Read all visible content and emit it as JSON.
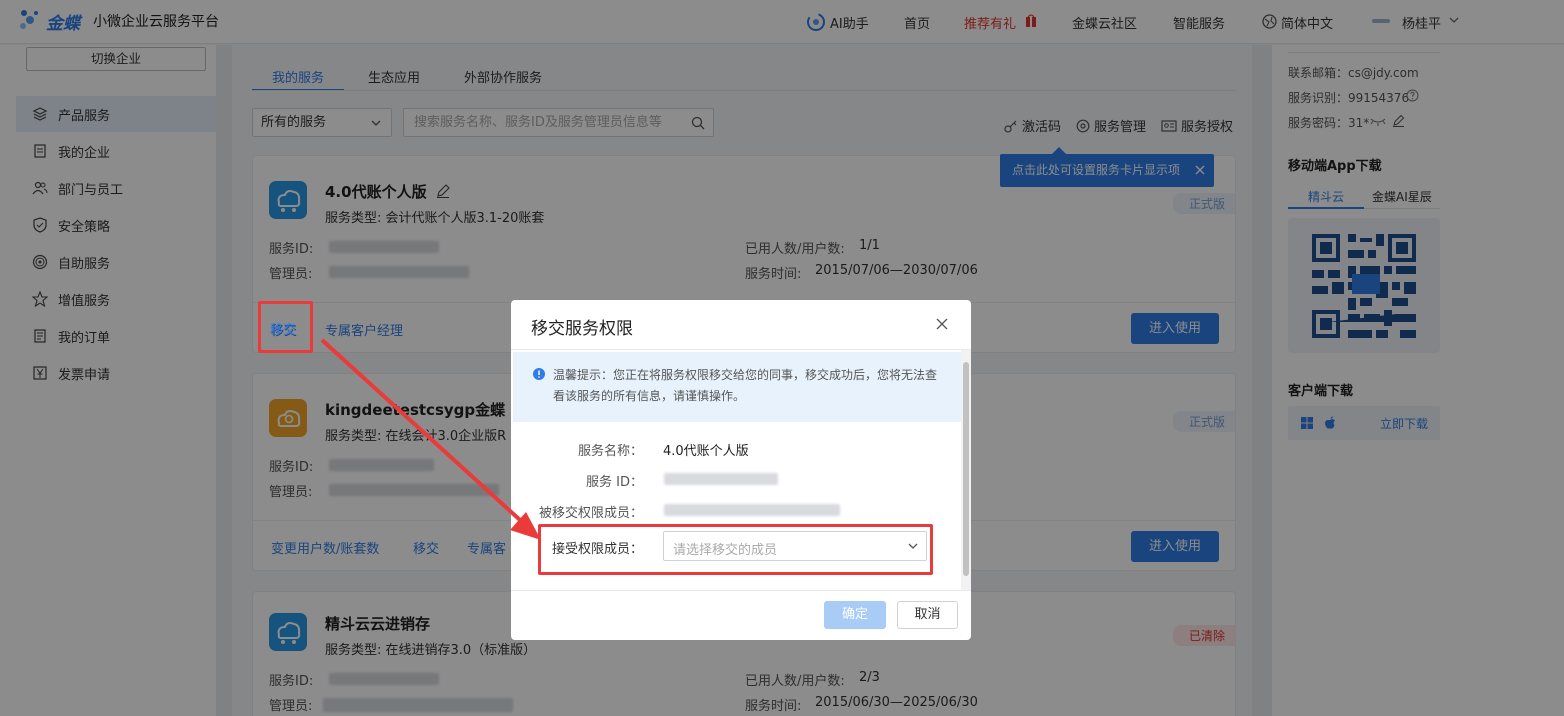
{
  "header": {
    "brand": "金蝶",
    "platform": "小微企业云服务平台",
    "nav": [
      "AI助手",
      "首页",
      "推荐有礼",
      "金蝶云社区",
      "智能服务",
      "简体中文"
    ],
    "user_name": "杨桂平"
  },
  "sidebar": {
    "switch_label": "切换企业",
    "items": [
      {
        "label": "产品服务",
        "icon": "layers-icon"
      },
      {
        "label": "我的企业",
        "icon": "document-icon"
      },
      {
        "label": "部门与员工",
        "icon": "people-icon"
      },
      {
        "label": "安全策略",
        "icon": "shield-icon"
      },
      {
        "label": "自助服务",
        "icon": "target-icon"
      },
      {
        "label": "增值服务",
        "icon": "star-icon"
      },
      {
        "label": "我的订单",
        "icon": "list-icon"
      },
      {
        "label": "发票申请",
        "icon": "yen-icon"
      }
    ]
  },
  "main": {
    "tabs": [
      "我的服务",
      "生态应用",
      "外部协作服务"
    ],
    "filter_value": "所有的服务",
    "search_placeholder": "搜索服务名称、服务ID及服务管理员信息等",
    "tools": [
      "激活码",
      "服务管理",
      "服务授权"
    ],
    "tooltip": "点击此处可设置服务卡片显示项",
    "labels": {
      "service_id": "服务ID:",
      "admin": "管理员:",
      "used_users": "已用人数/用户数:",
      "service_time": "服务时间:",
      "enter": "进入使用"
    },
    "cards": [
      {
        "title": "4.0代账个人版",
        "type": "服务类型: 会计代账个人版3.1-20账套",
        "status": "正式版",
        "users": "1/1",
        "time": "2015/07/06—2030/07/06",
        "actions": [
          "移交",
          "专属客户经理"
        ]
      },
      {
        "title": "kingdeetestcsygp金蝶",
        "type": "服务类型: 在线会计3.0企业版R",
        "status": "正式版",
        "actions": [
          "变更用户数/账套数",
          "移交",
          "专属客"
        ]
      },
      {
        "title": "精斗云云进销存",
        "type": "服务类型: 在线进销存3.0（标准版）",
        "status": "已清除",
        "users": "2/3",
        "time": "2015/06/30—2025/06/30"
      }
    ]
  },
  "right_panel": {
    "email": "联系邮箱：cs@jdy.com",
    "service_code": "服务识别：99154376",
    "service_password": "服务密码：31*",
    "app_download_title": "移动端App下载",
    "app_tabs": [
      "精斗云",
      "金蝶AI星辰"
    ],
    "client_download_title": "客户端下载",
    "download_now": "立即下载"
  },
  "modal": {
    "title": "移交服务权限",
    "notice": "温馨提示：您正在将服务权限移交给您的同事，移交成功后，您将无法查看该服务的所有信息，请谨慎操作。",
    "fields": {
      "service_name_label": "服务名称：",
      "service_name_value": "4.0代账个人版",
      "service_id_label": "服务 ID：",
      "from_member_label": "被移交权限成员：",
      "to_member_label": "接受权限成员：",
      "to_member_placeholder": "请选择移交的成员"
    },
    "confirm": "确定",
    "cancel": "取消"
  },
  "colors": {
    "brand": "#2f7ce6",
    "accent_red": "#e0342d",
    "highlight_red": "#ea3a3a"
  }
}
